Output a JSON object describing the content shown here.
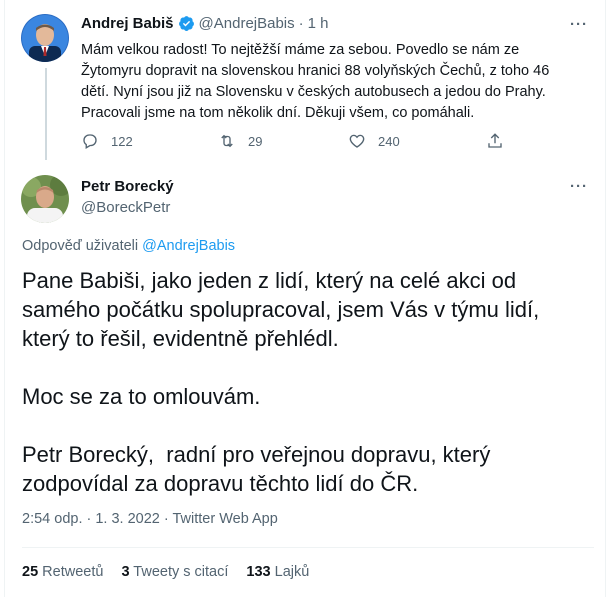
{
  "colors": {
    "accent": "#1d9bf0",
    "text": "#0f1419",
    "muted": "#536471",
    "border": "#eff3f4"
  },
  "parent_tweet": {
    "author_name": "Andrej Babiš",
    "verified_icon": "verified-badge-icon",
    "handle": "@AndrejBabis",
    "dot": "·",
    "time": "1 h",
    "more_icon": "more-icon",
    "body": "Mám velkou radost! To nejtěžší máme za sebou. Povedlo se nám ze Žytomyru dopravit na slovenskou hranici 88 volyňských Čechů, z toho 46 dětí. Nyní jsou již na Slovensku v českých autobusech a jedou do Prahy. Pracovali jsme na tom několik dní. Děkuji všem, co pomáhali.",
    "actions": {
      "reply_icon": "reply-icon",
      "reply_count": "122",
      "retweet_icon": "retweet-icon",
      "retweet_count": "29",
      "like_icon": "heart-icon",
      "like_count": "240",
      "share_icon": "share-icon"
    }
  },
  "main_tweet": {
    "author_name": "Petr Borecký",
    "handle": "@BoreckPetr",
    "more_icon": "more-icon",
    "reply_label": "Odpověď uživateli",
    "reply_mention": "@AndrejBabis",
    "paragraphs": [
      "Pane Babiši, jako jeden z lidí, který na celé akci od samého počátku spolupracoval, jsem Vás v týmu lidí, který to řešil, evidentně přehlédl.",
      "Moc se za to omlouvám.",
      "Petr Borecký,  radní pro veřejnou dopravu, který zodpovídal za dopravu těchto lidí do ČR."
    ],
    "meta": "2:54 odp. · 1. 3. 2022 · Twitter Web App",
    "stats": {
      "retweets_count": "25",
      "retweets_label": "Retweetů",
      "quotes_count": "3",
      "quotes_label": "Tweety s citací",
      "likes_count": "133",
      "likes_label": "Lajků"
    }
  }
}
